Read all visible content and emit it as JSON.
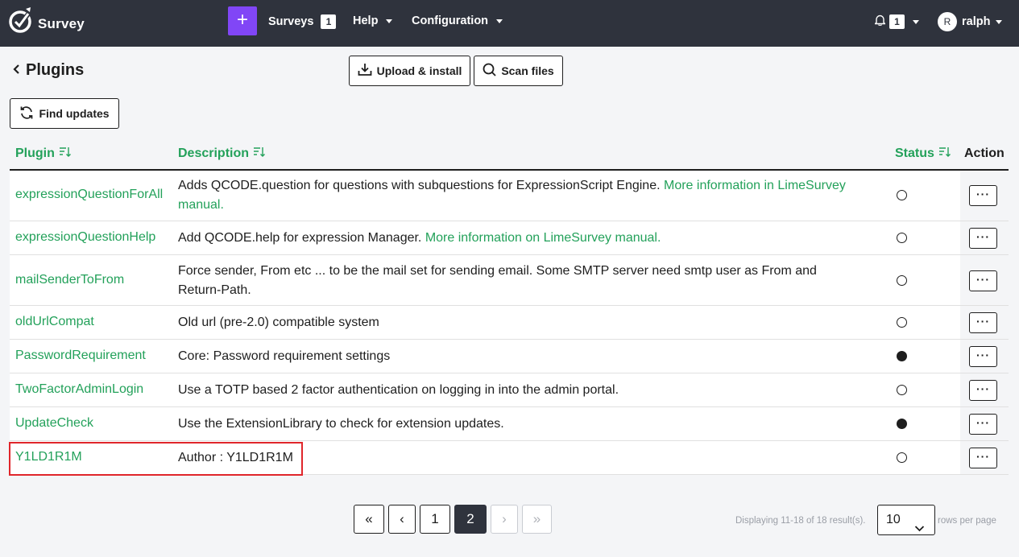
{
  "navbar": {
    "brand": "Survey",
    "surveys_label": "Surveys",
    "surveys_count": "1",
    "help_label": "Help",
    "configuration_label": "Configuration",
    "notifications_count": "1",
    "user_initial": "R",
    "user_name": "ralph"
  },
  "page": {
    "title": "Plugins",
    "upload_label": "Upload & install",
    "scan_label": "Scan files",
    "find_updates_label": "Find updates"
  },
  "table": {
    "headers": {
      "plugin": "Plugin",
      "description": "Description",
      "status": "Status",
      "action": "Action"
    },
    "rows": [
      {
        "name": "expressionQuestionForAll",
        "description": "Adds QCODE.question for questions with subquestions for ExpressionScript Engine.",
        "link": "More information in LimeSurvey manual.",
        "active": false
      },
      {
        "name": "expressionQuestionHelp",
        "description": "Add QCODE.help for expression Manager.",
        "link": "More information on LimeSurvey manual.",
        "active": false
      },
      {
        "name": "mailSenderToFrom",
        "description": "Force sender, From etc ... to be the mail set for sending email. Some SMTP server need smtp user as From and Return-Path.",
        "link": "",
        "active": false
      },
      {
        "name": "oldUrlCompat",
        "description": "Old url (pre-2.0) compatible system",
        "link": "",
        "active": false
      },
      {
        "name": "PasswordRequirement",
        "description": "Core: Password requirement settings",
        "link": "",
        "active": true
      },
      {
        "name": "TwoFactorAdminLogin",
        "description": "Use a TOTP based 2 factor authentication on logging in into the admin portal.",
        "link": "",
        "active": false
      },
      {
        "name": "UpdateCheck",
        "description": "Use the ExtensionLibrary to check for extension updates.",
        "link": "",
        "active": true
      },
      {
        "name": "Y1LD1R1M",
        "description": "Author : Y1LD1R1M",
        "link": "",
        "active": false
      }
    ],
    "action_label": "···"
  },
  "pagination": {
    "first": "«",
    "prev": "‹",
    "pages": [
      "1",
      "2"
    ],
    "current_page": "2",
    "next": "›",
    "last": "»",
    "summary": "Displaying 11-18 of 18 result(s).",
    "page_size": "10",
    "rows_per_page_label": "rows per page"
  },
  "colors": {
    "navbar_bg": "#2f333d",
    "accent_purple": "#8146f6",
    "link_green": "#23a15a",
    "highlight_red": "#e0262b"
  }
}
